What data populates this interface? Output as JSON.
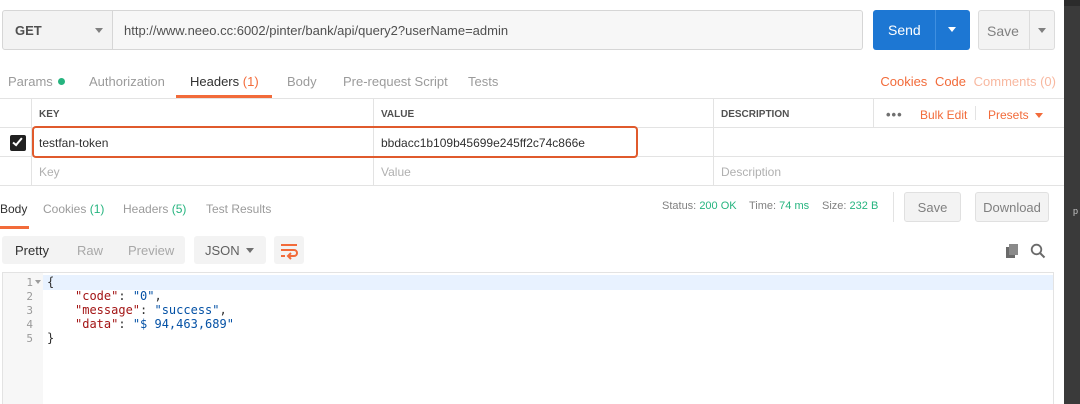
{
  "request": {
    "method": "GET",
    "url": "http://www.neeo.cc:6002/pinter/bank/api/query2?userName=admin",
    "send_label": "Send",
    "save_label": "Save"
  },
  "request_tabs": {
    "params": "Params",
    "authorization": "Authorization",
    "headers": "Headers",
    "headers_count": "(1)",
    "body": "Body",
    "pre_request_script": "Pre-request Script",
    "tests": "Tests",
    "cookies": "Cookies",
    "code": "Code",
    "comments": "Comments (0)"
  },
  "headers_table": {
    "columns": {
      "key": "KEY",
      "value": "VALUE",
      "description": "DESCRIPTION"
    },
    "more_icon": "•••",
    "bulk_edit": "Bulk Edit",
    "presets": "Presets",
    "rows": [
      {
        "checked": true,
        "key": "testfan-token",
        "value": "bbdacc1b109b45699e245ff2c74c866e",
        "description": ""
      }
    ],
    "placeholders": {
      "key": "Key",
      "value": "Value",
      "description": "Description"
    }
  },
  "response_tabs": {
    "body": "Body",
    "cookies": "Cookies",
    "cookies_count": "(1)",
    "headers": "Headers",
    "headers_count": "(5)",
    "test_results": "Test Results"
  },
  "response_status": {
    "status_label": "Status:",
    "status_value": "200 OK",
    "time_label": "Time:",
    "time_value": "74 ms",
    "size_label": "Size:",
    "size_value": "232 B",
    "save_label": "Save",
    "download_label": "Download"
  },
  "body_view": {
    "pretty": "Pretty",
    "raw": "Raw",
    "preview": "Preview",
    "format": "JSON"
  },
  "code_lines": [
    {
      "num": "1",
      "text": "{"
    },
    {
      "num": "2",
      "key": "\"code\"",
      "value": "\"0\"",
      "suffix": ","
    },
    {
      "num": "3",
      "key": "\"message\"",
      "value": "\"success\"",
      "suffix": ","
    },
    {
      "num": "4",
      "key": "\"data\"",
      "value": "\"$ 94,463,689\"",
      "suffix": ""
    },
    {
      "num": "5",
      "text": "}"
    }
  ],
  "colors": {
    "accent": "#f26b3a",
    "send_blue": "#1d77d3",
    "status_green": "#26b47f",
    "highlight_red": "#e05a2c"
  },
  "edge_glyph": "p"
}
